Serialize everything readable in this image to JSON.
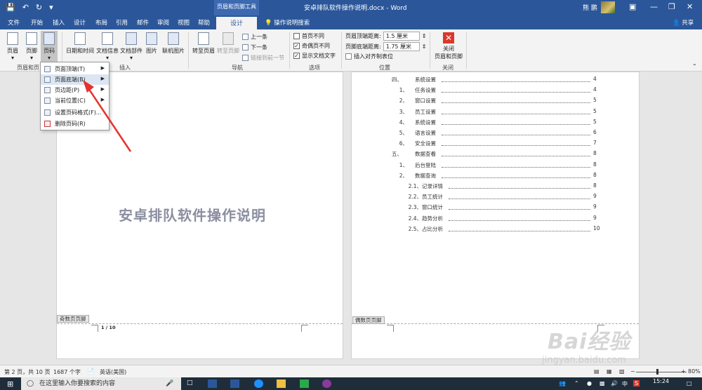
{
  "title_bar": {
    "context_tool_label": "页眉和页脚工具",
    "document_title": "安卓排队软件操作说明.docx - Word",
    "user_name": "熊 鹏"
  },
  "tabs": {
    "items": [
      "文件",
      "开始",
      "插入",
      "设计",
      "布局",
      "引用",
      "邮件",
      "审阅",
      "视图",
      "帮助"
    ],
    "active": "设计",
    "tell_me": "操作说明搜索",
    "share": "共享"
  },
  "ribbon": {
    "header_footer": {
      "header": "页眉",
      "footer": "页脚",
      "page_number": "页码",
      "group": "页眉和页"
    },
    "insert": {
      "datetime": "日期和时间",
      "docinfo": "文档信息",
      "quickparts": "文档部件",
      "picture": "图片",
      "online_picture": "联机图片",
      "group": "插入"
    },
    "navigation": {
      "goto_header": "转至页眉",
      "goto_footer": "转至页脚",
      "previous": "上一条",
      "next": "下一条",
      "link_previous": "链接到前一节",
      "group": "导航"
    },
    "options": {
      "different_first": "首页不同",
      "different_odd_even": "奇偶页不同",
      "show_doc_text": "显示文档文字",
      "group": "选项"
    },
    "position": {
      "header_from_top": "页眉顶端距离:",
      "header_value": "1.5 厘米",
      "footer_from_bottom": "页脚底端距离:",
      "footer_value": "1.75 厘米",
      "insert_align_tab": "插入对齐制表位",
      "group": "位置"
    },
    "close": {
      "label_line1": "关闭",
      "label_line2": "页眉和页脚",
      "group": "关闭"
    }
  },
  "dropdown": {
    "items": [
      {
        "label": "页面顶端(T)",
        "submenu": true
      },
      {
        "label": "页面底端(B)",
        "submenu": true
      },
      {
        "label": "页边距(P)",
        "submenu": true
      },
      {
        "label": "当前位置(C)",
        "submenu": true
      },
      {
        "label": "设置页码格式(F)...",
        "submenu": false
      },
      {
        "label": "删除页码(R)",
        "submenu": false
      }
    ]
  },
  "left_page": {
    "title": "安卓排队软件操作说明",
    "footer_tag": "奇数页页脚",
    "page_number": "1 / 10"
  },
  "right_page": {
    "footer_tag": "偶数页页脚",
    "toc": [
      {
        "num": "四、",
        "text": "系统设置",
        "page": "4"
      },
      {
        "num": "1、",
        "text": "任务设置",
        "page": "4"
      },
      {
        "num": "2、",
        "text": "窗口设置",
        "page": "5"
      },
      {
        "num": "3、",
        "text": "员工设置",
        "page": "5"
      },
      {
        "num": "4、",
        "text": "系统设置",
        "page": "5"
      },
      {
        "num": "5、",
        "text": "语言设置",
        "page": "6"
      },
      {
        "num": "6、",
        "text": "安全设置",
        "page": "7"
      },
      {
        "num": "五、",
        "text": "数据查看",
        "page": "8"
      },
      {
        "num": "1、",
        "text": "后台登陆",
        "page": "8"
      },
      {
        "num": "2、",
        "text": "数据查询",
        "page": "8"
      },
      {
        "num": "2.1、",
        "text": "记录详情",
        "page": "8"
      },
      {
        "num": "2.2、",
        "text": "员工统计",
        "page": "9"
      },
      {
        "num": "2.3、",
        "text": "窗口统计",
        "page": "9"
      },
      {
        "num": "2.4、",
        "text": "趋势分析",
        "page": "9"
      },
      {
        "num": "2.5、",
        "text": "占比分析",
        "page": "10"
      }
    ]
  },
  "status_bar": {
    "page_info": "第 2 页，共 10 页",
    "word_count": "1687 个字",
    "language": "英语(美国)",
    "zoom": "80%",
    "zoom_fraction": 0.8
  },
  "taskbar": {
    "search_placeholder": "在这里输入你要搜索的内容",
    "time": "15:24"
  },
  "watermark": {
    "brand": "Bai经验",
    "url": "jingyan.baidu.com"
  },
  "colors": {
    "word_blue": "#2b579a",
    "close_red": "#d9382a",
    "arrow_red": "#e5322d"
  }
}
